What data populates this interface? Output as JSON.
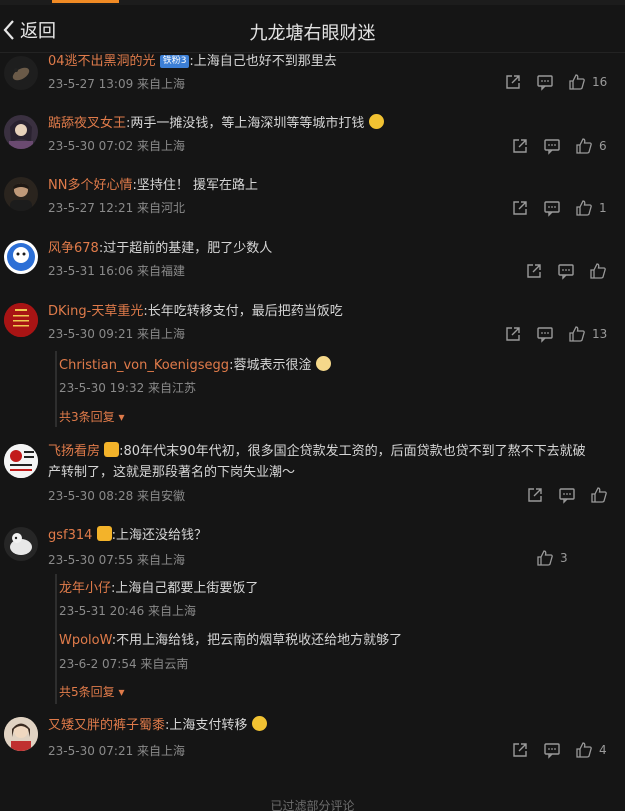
{
  "header": {
    "back_label": "返回",
    "title": "九龙塘右眼财迷"
  },
  "comments": [
    {
      "user": "04逃不出黑洞的光",
      "badge": "铁粉3",
      "text": ":上海自己也好不到那里去",
      "time": "23-5-27 13:09 来自上海",
      "likes": "16"
    },
    {
      "user": "踮舔夜叉女王",
      "text": ":两手一摊没钱，等上海深圳等等城市打钱",
      "time": "23-5-30 07:02 来自上海",
      "likes": "6"
    },
    {
      "user": "NN多个好心情",
      "text": ":坚持住！ 援军在路上",
      "time": "23-5-27 12:21 来自河北",
      "likes": "1"
    },
    {
      "user": "风争678",
      "text": ":过于超前的基建，肥了少数人",
      "time": "23-5-31 16:06 来自福建",
      "likes": ""
    },
    {
      "user": "DKing-天草重光",
      "text": ":长年吃转移支付，最后把药当饭吃",
      "time": "23-5-30 09:21 来自上海",
      "likes": "13",
      "replies": [
        {
          "user": "Christian_von_Koenigsegg",
          "text": ":蓉城表示很淦",
          "time": "23-5-30 19:32 来自江苏"
        }
      ],
      "more": "共3条回复"
    },
    {
      "user": "飞扬看房",
      "text": ":80年代末90年代初，很多国企贷款发工资的，后面贷款也贷不到了熬不下去就破",
      "text2": "产转制了，这就是那段著名的下岗失业潮～",
      "time": "23-5-30 08:28 来自安徽",
      "likes": ""
    },
    {
      "user": "gsf314",
      "text": ":上海还没给钱？",
      "time": "23-5-30 07:55 来自上海",
      "likes": "3",
      "replies": [
        {
          "user": "龙年小仔",
          "text": ":上海自己都要上街要饭了",
          "time": "23-5-31 20:46 来自上海"
        },
        {
          "user": "WpoloW",
          "text": ":不用上海给钱，把云南的烟草税收还给地方就够了",
          "time": "23-6-2 07:54 来自云南"
        }
      ],
      "more": "共5条回复"
    },
    {
      "user": "又矮又胖的裤子蜀黍",
      "text": ":上海支付转移",
      "time": "23-5-30 07:21 来自上海",
      "likes": "4"
    }
  ],
  "footer": "已过滤部分评论",
  "colors": {
    "accent": "#f08a24",
    "username": "#e07b4a",
    "background": "#151515"
  },
  "icons": [
    "chevron-left-icon",
    "share-icon",
    "comment-icon",
    "like-icon"
  ]
}
